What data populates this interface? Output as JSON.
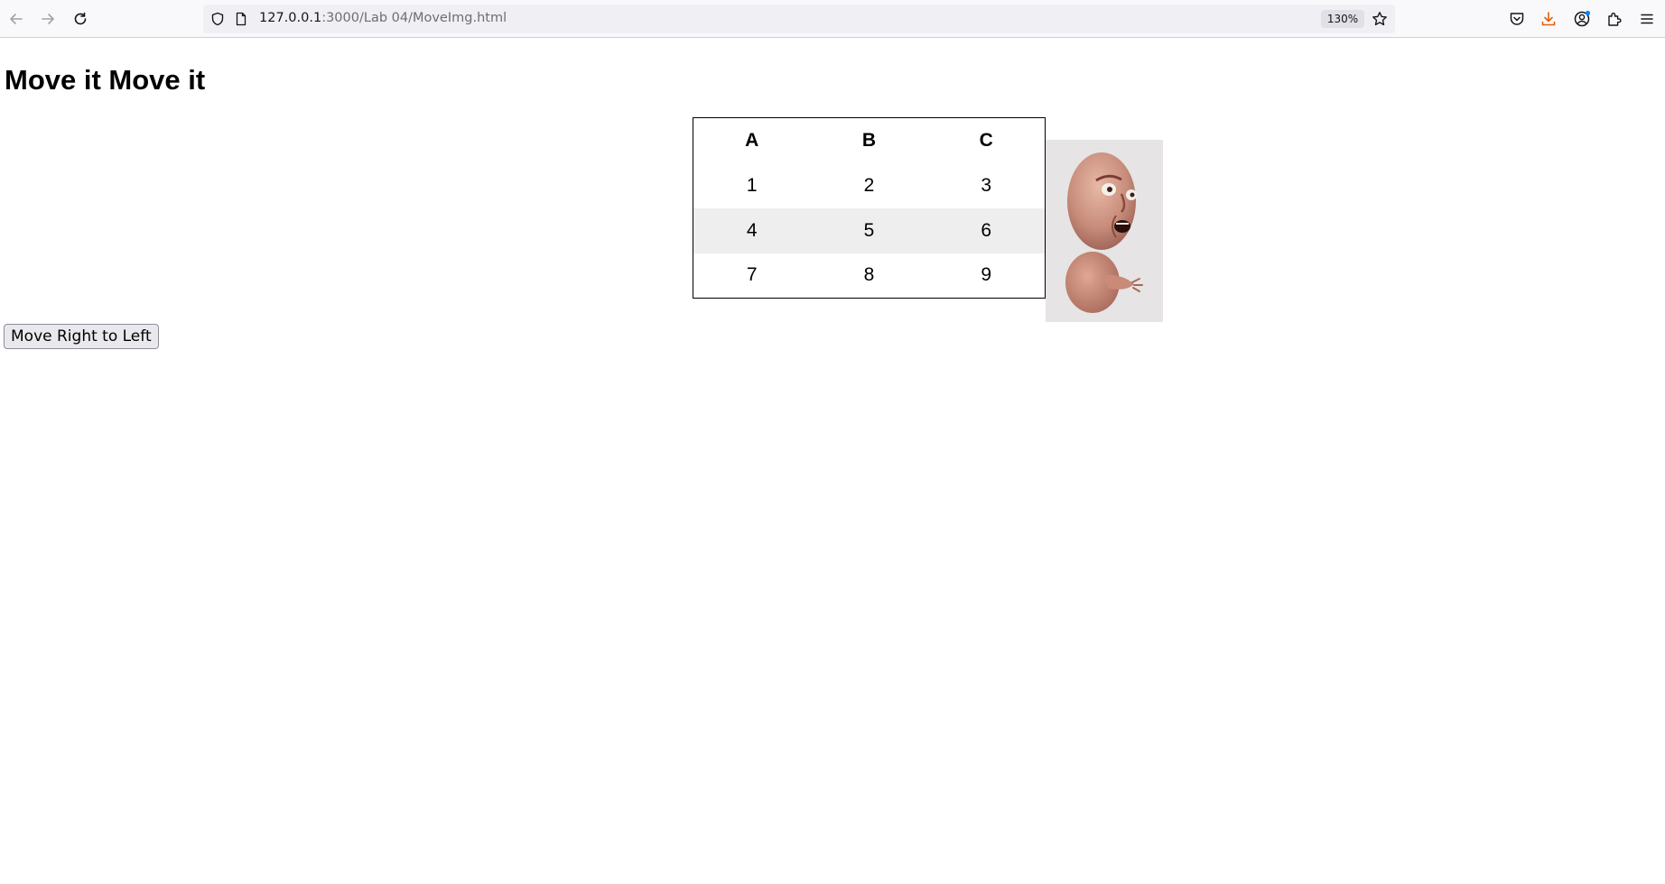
{
  "browser": {
    "url_host": "127.0.0.1",
    "url_path": ":3000/Lab 04/MoveImg.html",
    "zoom": "130%"
  },
  "page": {
    "title": "Move it Move it",
    "table": {
      "headers": [
        "A",
        "B",
        "C"
      ],
      "rows": [
        [
          "1",
          "2",
          "3"
        ],
        [
          "4",
          "5",
          "6"
        ],
        [
          "7",
          "8",
          "9"
        ]
      ]
    },
    "button_label": "Move Right to Left"
  },
  "colors": {
    "shaded_row": "#eeeeee",
    "download_accent": "#e66000",
    "account_badge": "#0a84ff"
  }
}
